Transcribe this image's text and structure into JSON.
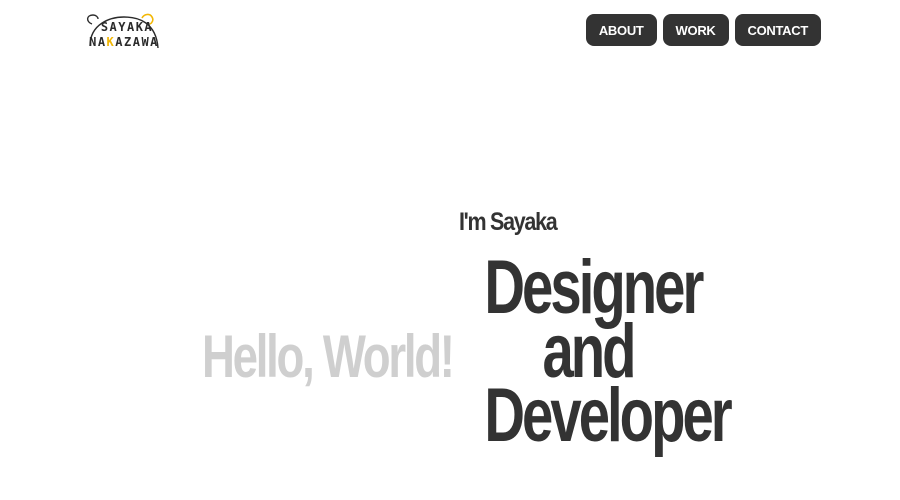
{
  "logo": {
    "line1": "SAYAKA",
    "line2_prefix": "NA",
    "line2_highlight": "K",
    "line2_suffix": "AZAWA",
    "accent_color": "#f2b705",
    "icon": "bear-outline-icon"
  },
  "nav": {
    "items": [
      {
        "label": "ABOUT"
      },
      {
        "label": "WORK"
      },
      {
        "label": "CONTACT"
      }
    ],
    "button_color": "#333333"
  },
  "hero": {
    "intro": "I'm Sayaka",
    "background_text": "Hello, World!",
    "role_lines": [
      "Designer",
      "and",
      "Developer"
    ]
  }
}
